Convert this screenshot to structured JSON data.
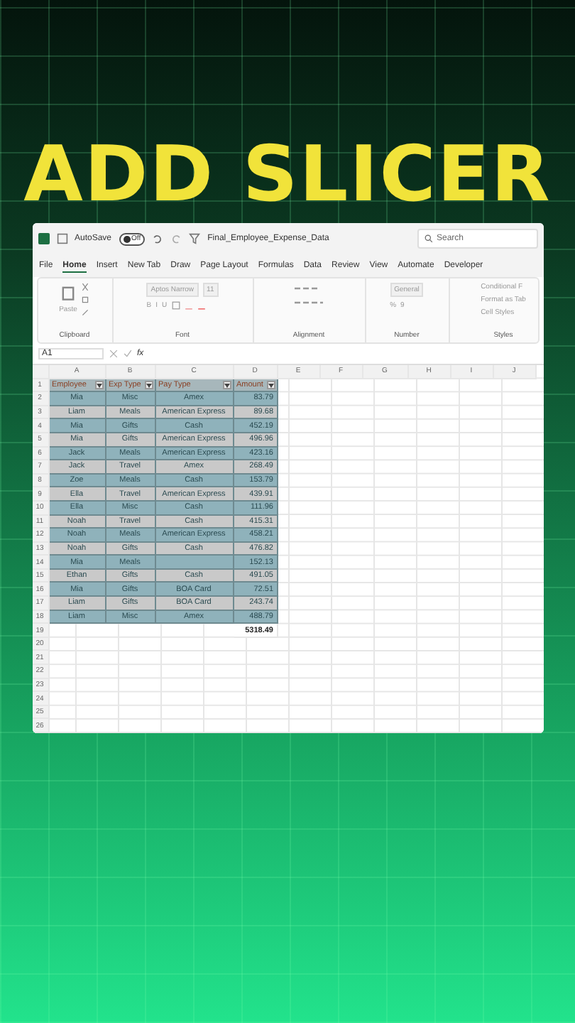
{
  "headline": "ADD SLICER",
  "title_bar": {
    "autosave_label": "AutoSave",
    "autosave_state": "Off",
    "autosave_on": false,
    "file_name": "Final_Employee_Expense_Data",
    "search_placeholder": "Search"
  },
  "tabs": [
    {
      "label": "File",
      "selected": false
    },
    {
      "label": "Home",
      "selected": true
    },
    {
      "label": "Insert",
      "selected": false
    },
    {
      "label": "New Tab",
      "selected": false
    },
    {
      "label": "Draw",
      "selected": false
    },
    {
      "label": "Page Layout",
      "selected": false
    },
    {
      "label": "Formulas",
      "selected": false
    },
    {
      "label": "Data",
      "selected": false
    },
    {
      "label": "Review",
      "selected": false
    },
    {
      "label": "View",
      "selected": false
    },
    {
      "label": "Automate",
      "selected": false
    },
    {
      "label": "Developer",
      "selected": false
    }
  ],
  "ribbon": {
    "paste": "Paste",
    "font_name": "Aptos Narrow",
    "font_size": "11",
    "bold": "B",
    "italic": "I",
    "underline": "U",
    "number_format": "General",
    "percent": "%",
    "comma": "9",
    "conditional": "Conditional F",
    "format_table": "Format as Tab",
    "cell_styles": "Cell Styles",
    "groups": [
      "Clipboard",
      "Font",
      "Alignment",
      "Number",
      "Styles"
    ]
  },
  "formula_bar": {
    "name_box": "A1",
    "fx": "fx"
  },
  "sheet": {
    "columns": [
      "A",
      "B",
      "C",
      "D",
      "E",
      "F",
      "G",
      "H",
      "I",
      "J"
    ],
    "header_number": "1",
    "header": [
      "Employee",
      "Exp Type",
      "Pay Type",
      "Amount"
    ],
    "rows": [
      {
        "number": "2",
        "name": "Mia",
        "category": "Misc",
        "payment": "Amex",
        "amount": "83.79"
      },
      {
        "number": "3",
        "name": "Liam",
        "category": "Meals",
        "payment": "American Express",
        "amount": "89.68"
      },
      {
        "number": "4",
        "name": "Mia",
        "category": "Gifts",
        "payment": "Cash",
        "amount": "452.19"
      },
      {
        "number": "5",
        "name": "Mia",
        "category": "Gifts",
        "payment": "American Express",
        "amount": "496.96"
      },
      {
        "number": "6",
        "name": "Jack",
        "category": "Meals",
        "payment": "American Express",
        "amount": "423.16"
      },
      {
        "number": "7",
        "name": "Jack",
        "category": "Travel",
        "payment": "Amex",
        "amount": "268.49"
      },
      {
        "number": "8",
        "name": "Zoe",
        "category": "Meals",
        "payment": "Cash",
        "amount": "153.79"
      },
      {
        "number": "9",
        "name": "Ella",
        "category": "Travel",
        "payment": "American Express",
        "amount": "439.91"
      },
      {
        "number": "10",
        "name": "Ella",
        "category": "Misc",
        "payment": "Cash",
        "amount": "111.96"
      },
      {
        "number": "11",
        "name": "Noah",
        "category": "Travel",
        "payment": "Cash",
        "amount": "415.31"
      },
      {
        "number": "12",
        "name": "Noah",
        "category": "Meals",
        "payment": "American Express",
        "amount": "458.21"
      },
      {
        "number": "13",
        "name": "Noah",
        "category": "Gifts",
        "payment": "Cash",
        "amount": "476.82"
      },
      {
        "number": "14",
        "name": "Mia",
        "category": "Meals",
        "amount": "152.13"
      },
      {
        "number": "15",
        "name": "Ethan",
        "category": "Gifts",
        "payment": "Cash",
        "amount": "491.05"
      },
      {
        "number": "16",
        "name": "Mia",
        "category": "Gifts",
        "payment": "BOA Card",
        "amount": "72.51"
      },
      {
        "number": "17",
        "name": "Liam",
        "category": "Gifts",
        "payment": "BOA Card",
        "amount": "243.74"
      },
      {
        "number": "18",
        "name": "Liam",
        "category": "Misc",
        "payment": "Amex",
        "amount": "488.79"
      }
    ],
    "total_row": {
      "number": "19",
      "value": "5318.49"
    },
    "empty_rows": [
      "20",
      "21",
      "22",
      "23",
      "24",
      "25",
      "26"
    ]
  }
}
